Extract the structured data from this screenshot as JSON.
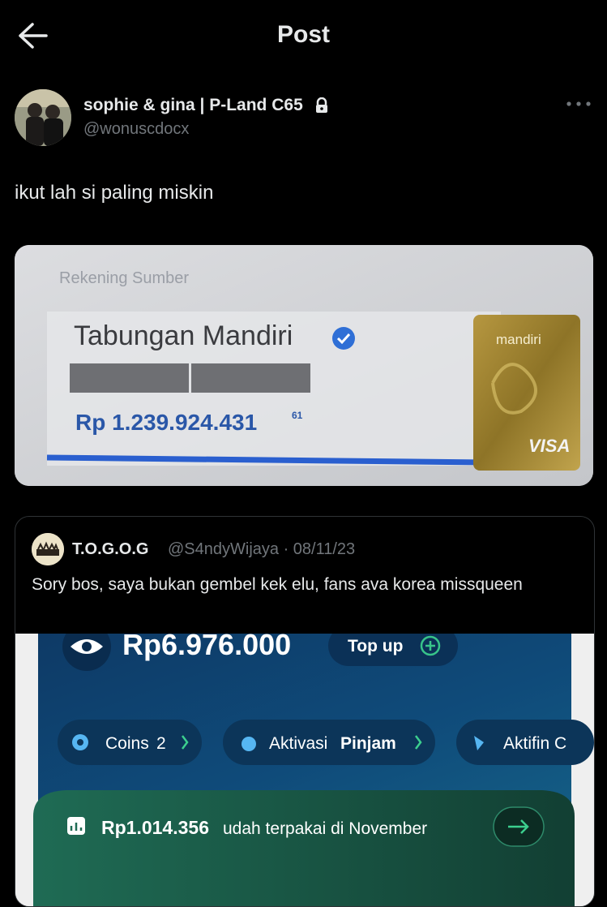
{
  "header": {
    "title": "Post"
  },
  "tweet": {
    "display_name": "sophie & gina | P-Land C65",
    "handle": "@wonuscdocx",
    "text": "ikut lah si paling miskin"
  },
  "bank_image": {
    "section_label": "Rekening Sumber",
    "account_name": "Tabungan Mandiri",
    "balance": "Rp 1.239.924.431",
    "balance_cents": "61",
    "card_brand": "mandiri",
    "card_network": "VISA"
  },
  "quote": {
    "name": "T.O.G.O.G",
    "handle_date": "@S4ndyWijaya · 08/11/23",
    "text": "Sory bos, saya bukan gembel kek elu, fans ava korea missqueen",
    "app": {
      "balance": "Rp6.976.000",
      "topup_label": "Top up",
      "chips": {
        "coins_label": "Coins",
        "coins_count": "2",
        "aktivasi_prefix": "Aktivasi",
        "aktivasi_bold": "Pinjam",
        "aktifin_label": "Aktifin C"
      },
      "spent_amount": "Rp1.014.356",
      "spent_text": "udah terpakai di November"
    }
  },
  "colors": {
    "background": "#000000",
    "text": "#e7e9ea",
    "muted": "#71767b",
    "border": "#2f3336",
    "mandiri_blue": "#1f4e9a"
  }
}
